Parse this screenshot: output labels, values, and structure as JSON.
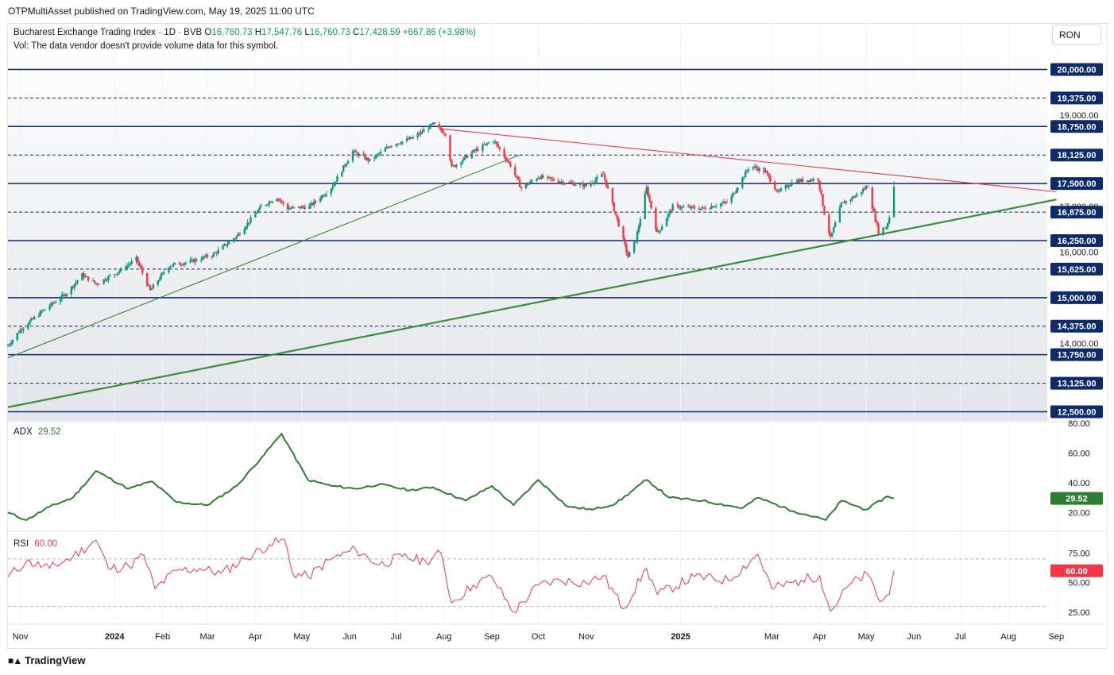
{
  "publisher_line": "OTPMultiAsset published on TradingView.com, May 19, 2025 11:00 UTC",
  "symbol": {
    "name": "Bucharest Exchange Trading Index · 1D · BVB",
    "o_label": "O",
    "o_value": "16,760.73",
    "h_label": "H",
    "h_value": "17,547.76",
    "l_label": "L",
    "l_value": "16,760.73",
    "c_label": "C",
    "c_value": "17,428.59",
    "change": "+667.86 (+3.98%)"
  },
  "vol_note": "Vol: The data vendor doesn't provide volume data for this symbol.",
  "currency": "RON",
  "brand": "TradingView",
  "colors": {
    "up": "#089981",
    "down": "#f23645",
    "level": "#0d2a6b",
    "trend_green": "#388e3c",
    "trend_red": "#f23645",
    "adx": "#2e7d32",
    "rsi": "#f23645"
  },
  "chart_data": [
    {
      "type": "candlestick",
      "title": "Bucharest Exchange Trading Index · 1D · BVB",
      "ylim": [
        12300,
        21000
      ],
      "price_ticks": [
        "19,000.00",
        "17,000.00",
        "16,000.00",
        "14,000.00"
      ],
      "levels": [
        {
          "value": 20000,
          "label": "20,000.00",
          "style": "solid"
        },
        {
          "value": 19375,
          "label": "19,375.00",
          "style": "dashed"
        },
        {
          "value": 18750,
          "label": "18,750.00",
          "style": "solid"
        },
        {
          "value": 18125,
          "label": "18,125.00",
          "style": "dashed"
        },
        {
          "value": 17500,
          "label": "17,500.00",
          "style": "solid"
        },
        {
          "value": 16875,
          "label": "16,875.00",
          "style": "dashed"
        },
        {
          "value": 16250,
          "label": "16,250.00",
          "style": "solid"
        },
        {
          "value": 15625,
          "label": "15,625.00",
          "style": "dashed"
        },
        {
          "value": 15000,
          "label": "15,000.00",
          "style": "solid"
        },
        {
          "value": 14375,
          "label": "14,375.00",
          "style": "dashed"
        },
        {
          "value": 13750,
          "label": "13,750.00",
          "style": "solid"
        },
        {
          "value": 13125,
          "label": "13,125.00",
          "style": "dashed"
        },
        {
          "value": 12500,
          "label": "12,500.00",
          "style": "solid"
        }
      ],
      "time_axis": [
        "Nov",
        "2024",
        "Feb",
        "Mar",
        "Apr",
        "May",
        "Jun",
        "Jul",
        "Aug",
        "Sep",
        "Oct",
        "Nov",
        "2025",
        "Mar",
        "Apr",
        "May",
        "Jun",
        "Jul",
        "Aug",
        "Sep"
      ],
      "closes": [
        {
          "date": "2023-10-24",
          "close": 13950
        },
        {
          "date": "2023-11-01",
          "close": 14300
        },
        {
          "date": "2023-11-15",
          "close": 14700
        },
        {
          "date": "2023-12-01",
          "close": 15100
        },
        {
          "date": "2023-12-11",
          "close": 15500
        },
        {
          "date": "2023-12-20",
          "close": 15300
        },
        {
          "date": "2024-01-05",
          "close": 15600
        },
        {
          "date": "2024-01-15",
          "close": 15850
        },
        {
          "date": "2024-01-24",
          "close": 15150
        },
        {
          "date": "2024-02-05",
          "close": 15700
        },
        {
          "date": "2024-02-20",
          "close": 15800
        },
        {
          "date": "2024-03-05",
          "close": 15950
        },
        {
          "date": "2024-03-20",
          "close": 16350
        },
        {
          "date": "2024-04-05",
          "close": 17000
        },
        {
          "date": "2024-04-15",
          "close": 17200
        },
        {
          "date": "2024-04-22",
          "close": 16950
        },
        {
          "date": "2024-05-06",
          "close": 17000
        },
        {
          "date": "2024-05-20",
          "close": 17400
        },
        {
          "date": "2024-06-03",
          "close": 18200
        },
        {
          "date": "2024-06-14",
          "close": 18000
        },
        {
          "date": "2024-06-28",
          "close": 18350
        },
        {
          "date": "2024-07-12",
          "close": 18500
        },
        {
          "date": "2024-07-25",
          "close": 18800
        },
        {
          "date": "2024-08-02",
          "close": 18600
        },
        {
          "date": "2024-08-06",
          "close": 17850
        },
        {
          "date": "2024-08-20",
          "close": 18200
        },
        {
          "date": "2024-09-02",
          "close": 18450
        },
        {
          "date": "2024-09-13",
          "close": 17900
        },
        {
          "date": "2024-09-20",
          "close": 17400
        },
        {
          "date": "2024-10-01",
          "close": 17650
        },
        {
          "date": "2024-10-15",
          "close": 17550
        },
        {
          "date": "2024-11-01",
          "close": 17450
        },
        {
          "date": "2024-11-12",
          "close": 17700
        },
        {
          "date": "2024-11-22",
          "close": 16600
        },
        {
          "date": "2024-11-28",
          "close": 15900
        },
        {
          "date": "2024-12-03",
          "close": 16250
        },
        {
          "date": "2024-12-10",
          "close": 17400
        },
        {
          "date": "2024-12-17",
          "close": 16400
        },
        {
          "date": "2024-12-27",
          "close": 17000
        },
        {
          "date": "2025-01-15",
          "close": 16950
        },
        {
          "date": "2025-02-01",
          "close": 17100
        },
        {
          "date": "2025-02-15",
          "close": 17900
        },
        {
          "date": "2025-02-25",
          "close": 17750
        },
        {
          "date": "2025-03-05",
          "close": 17300
        },
        {
          "date": "2025-03-15",
          "close": 17550
        },
        {
          "date": "2025-03-31",
          "close": 17600
        },
        {
          "date": "2025-04-04",
          "close": 16850
        },
        {
          "date": "2025-04-08",
          "close": 16300
        },
        {
          "date": "2025-04-15",
          "close": 17050
        },
        {
          "date": "2025-04-25",
          "close": 17250
        },
        {
          "date": "2025-05-02",
          "close": 17450
        },
        {
          "date": "2025-05-06",
          "close": 16850
        },
        {
          "date": "2025-05-09",
          "close": 16450
        },
        {
          "date": "2025-05-14",
          "close": 16550
        },
        {
          "date": "2025-05-16",
          "close": 16760
        },
        {
          "date": "2025-05-19",
          "close": 17428.59
        }
      ],
      "trendlines": [
        {
          "name": "support-long",
          "color": "green",
          "from": {
            "date": "2023-10-24",
            "value": 12600
          },
          "to": {
            "date": "2025-09-01",
            "value": 17150
          }
        },
        {
          "name": "support-short",
          "color": "green",
          "from": {
            "date": "2023-10-24",
            "value": 13680
          },
          "to": {
            "date": "2024-09-20",
            "value": 18140
          }
        },
        {
          "name": "resistance",
          "color": "red",
          "from": {
            "date": "2024-07-30",
            "value": 18700
          },
          "to": {
            "date": "2025-09-01",
            "value": 17320
          }
        }
      ],
      "last_price": 17428.59
    },
    {
      "type": "line",
      "title": "ADX",
      "last_value": "29.52",
      "ylim": [
        8,
        80
      ],
      "ticks": [
        "80.00",
        "60.00",
        "40.00",
        "20.00"
      ],
      "points": [
        {
          "date": "2023-10-24",
          "value": 20
        },
        {
          "date": "2023-11-05",
          "value": 15
        },
        {
          "date": "2023-11-20",
          "value": 24
        },
        {
          "date": "2023-12-05",
          "value": 30
        },
        {
          "date": "2023-12-20",
          "value": 48
        },
        {
          "date": "2024-01-10",
          "value": 36
        },
        {
          "date": "2024-01-25",
          "value": 41
        },
        {
          "date": "2024-02-10",
          "value": 27
        },
        {
          "date": "2024-03-01",
          "value": 25
        },
        {
          "date": "2024-03-20",
          "value": 38
        },
        {
          "date": "2024-04-05",
          "value": 57
        },
        {
          "date": "2024-04-18",
          "value": 73
        },
        {
          "date": "2024-05-05",
          "value": 42
        },
        {
          "date": "2024-05-20",
          "value": 38
        },
        {
          "date": "2024-06-05",
          "value": 36
        },
        {
          "date": "2024-06-20",
          "value": 39
        },
        {
          "date": "2024-07-10",
          "value": 35
        },
        {
          "date": "2024-07-25",
          "value": 37
        },
        {
          "date": "2024-08-15",
          "value": 28
        },
        {
          "date": "2024-09-01",
          "value": 38
        },
        {
          "date": "2024-09-15",
          "value": 25
        },
        {
          "date": "2024-10-01",
          "value": 42
        },
        {
          "date": "2024-10-20",
          "value": 24
        },
        {
          "date": "2024-11-05",
          "value": 22
        },
        {
          "date": "2024-11-20",
          "value": 26
        },
        {
          "date": "2024-12-10",
          "value": 42
        },
        {
          "date": "2024-12-25",
          "value": 30
        },
        {
          "date": "2025-01-15",
          "value": 28
        },
        {
          "date": "2025-02-10",
          "value": 23
        },
        {
          "date": "2025-02-20",
          "value": 30
        },
        {
          "date": "2025-03-15",
          "value": 21
        },
        {
          "date": "2025-04-05",
          "value": 15
        },
        {
          "date": "2025-04-15",
          "value": 28
        },
        {
          "date": "2025-05-01",
          "value": 22
        },
        {
          "date": "2025-05-15",
          "value": 31
        },
        {
          "date": "2025-05-19",
          "value": 29.52
        }
      ]
    },
    {
      "type": "line",
      "title": "RSI",
      "last_value": "60.00",
      "ylim": [
        15,
        92
      ],
      "ticks": [
        "75.00",
        "50.00",
        "25.00"
      ],
      "bands": [
        70,
        30
      ],
      "points": [
        {
          "date": "2023-10-24",
          "value": 55
        },
        {
          "date": "2023-11-05",
          "value": 68
        },
        {
          "date": "2023-11-20",
          "value": 62
        },
        {
          "date": "2023-12-05",
          "value": 72
        },
        {
          "date": "2023-12-20",
          "value": 86
        },
        {
          "date": "2023-12-28",
          "value": 62
        },
        {
          "date": "2024-01-10",
          "value": 64
        },
        {
          "date": "2024-01-20",
          "value": 73
        },
        {
          "date": "2024-01-27",
          "value": 45
        },
        {
          "date": "2024-02-10",
          "value": 60
        },
        {
          "date": "2024-02-25",
          "value": 62
        },
        {
          "date": "2024-03-10",
          "value": 58
        },
        {
          "date": "2024-03-25",
          "value": 70
        },
        {
          "date": "2024-04-10",
          "value": 82
        },
        {
          "date": "2024-04-20",
          "value": 86
        },
        {
          "date": "2024-04-25",
          "value": 58
        },
        {
          "date": "2024-05-05",
          "value": 55
        },
        {
          "date": "2024-05-20",
          "value": 70
        },
        {
          "date": "2024-06-05",
          "value": 78
        },
        {
          "date": "2024-06-20",
          "value": 65
        },
        {
          "date": "2024-07-05",
          "value": 72
        },
        {
          "date": "2024-07-20",
          "value": 68
        },
        {
          "date": "2024-07-30",
          "value": 75
        },
        {
          "date": "2024-08-06",
          "value": 33
        },
        {
          "date": "2024-08-20",
          "value": 48
        },
        {
          "date": "2024-09-01",
          "value": 55
        },
        {
          "date": "2024-09-15",
          "value": 25
        },
        {
          "date": "2024-10-01",
          "value": 48
        },
        {
          "date": "2024-10-15",
          "value": 52
        },
        {
          "date": "2024-11-01",
          "value": 50
        },
        {
          "date": "2024-11-12",
          "value": 56
        },
        {
          "date": "2024-11-25",
          "value": 28
        },
        {
          "date": "2024-12-10",
          "value": 62
        },
        {
          "date": "2024-12-17",
          "value": 40
        },
        {
          "date": "2025-01-10",
          "value": 55
        },
        {
          "date": "2025-02-01",
          "value": 52
        },
        {
          "date": "2025-02-20",
          "value": 74
        },
        {
          "date": "2025-03-01",
          "value": 45
        },
        {
          "date": "2025-03-20",
          "value": 52
        },
        {
          "date": "2025-04-01",
          "value": 56
        },
        {
          "date": "2025-04-08",
          "value": 26
        },
        {
          "date": "2025-04-20",
          "value": 48
        },
        {
          "date": "2025-05-02",
          "value": 57
        },
        {
          "date": "2025-05-10",
          "value": 34
        },
        {
          "date": "2025-05-16",
          "value": 40
        },
        {
          "date": "2025-05-19",
          "value": 60
        }
      ]
    }
  ]
}
